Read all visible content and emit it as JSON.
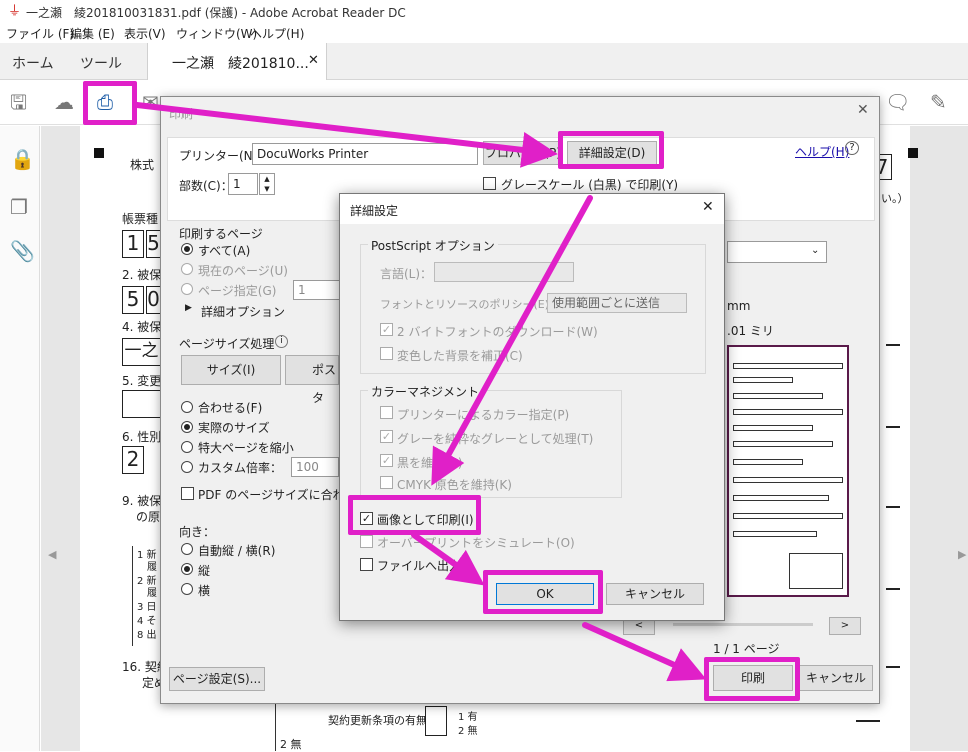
{
  "window": {
    "title": "一之瀬　綾201810031831.pdf (保護) - Adobe Acrobat Reader DC"
  },
  "menu": [
    "ファイル (F)",
    "編集 (E)",
    "表示(V)",
    "ウィンドウ(W)",
    "ヘルプ(H)"
  ],
  "tabs": {
    "home": "ホーム",
    "tools": "ツール",
    "document": "一之瀬　綾201810..."
  },
  "toolbar_icons": [
    "save-icon",
    "upload-icon",
    "print-icon",
    "mail-icon"
  ],
  "rail_icons": [
    "lock-icon",
    "copy-icon",
    "paperclip-icon"
  ],
  "document": {
    "items": [
      "株式",
      "帳票種",
      "2. 被保",
      "4. 被保",
      "5. 変更",
      "6. 性別",
      "9. 被保",
      "の原",
      "16. 契約",
      "定め",
      "2 無"
    ],
    "digits": [
      "1",
      "5",
      "5",
      "0",
      "一之",
      "2"
    ],
    "list_left": [
      "1 新",
      "履",
      "2 新",
      "履",
      "3 日",
      "4 そ",
      "8 出"
    ],
    "bottom_label": "契約更新条項の有無",
    "bottom_options": [
      "1 有",
      "2 無"
    ],
    "right_note": "さい。）",
    "right_marks": [
      "7"
    ]
  },
  "print_dialog": {
    "title": "印刷",
    "printer_label": "プリンター(N)：",
    "printer_value": "DocuWorks Printer",
    "properties_button": "プロパティ(P)",
    "advanced_button": "詳細設定(D)",
    "help_link": "ヘルプ(H)",
    "copies_label": "部数(C)：",
    "copies_value": "1",
    "grayscale_label": "グレースケール (白黒) で印刷(Y)",
    "pages_group": "印刷するページ",
    "pages_all": "すべて(A)",
    "pages_current": "現在のページ(U)",
    "pages_range": "ページ指定(G)",
    "pages_range_value": "1",
    "more_options": "詳細オプション",
    "sizing_group": "ページサイズ処理",
    "size_button": "サイズ(I)",
    "poster_button": "ポスタ",
    "fit": "合わせる(F)",
    "actual": "実際のサイズ",
    "shrink": "特大ページを縮小",
    "custom": "カスタム倍率：",
    "custom_value": "100",
    "choose_paper": "PDF のページサイズに合わせ",
    "orientation_label": "向き：",
    "auto": "自動縦 / 横(R)",
    "portrait": "縦",
    "landscape": "横",
    "page_setup_button": "ページ設定(S)...",
    "preview_mm": "mm",
    "preview_scale": ".01 ミリ",
    "preview_pager": "1 / 1 ページ",
    "prev_button": "<",
    "next_button": ">",
    "print_button": "印刷",
    "cancel_button": "キャンセル"
  },
  "advanced_dialog": {
    "title": "詳細設定",
    "postscript_group": "PostScript オプション",
    "language_label": "言語(L)：",
    "font_policy_label": "フォントとリソースのポリシー(E)：",
    "font_policy_value": "使用範囲ごとに送信",
    "two_byte": "2 バイトフォントのダウンロード(W)",
    "discolored_bg": "変色した背景を補正(C)",
    "color_group": "カラーマネジメント",
    "printer_color": "プリンターによるカラー指定(P)",
    "gray_as_gray": "グレーを純粋なグレーとして処理(T)",
    "black_preserve": "黒を維持(B)",
    "cmyk_preserve": "CMYK 原色を維持(K)",
    "print_as_image": "画像として印刷(I)",
    "overprint": "オーバープリントをシミュレート(O)",
    "print_to_file": "ファイルへ出力",
    "ok_button": "OK",
    "cancel_button": "キャンセル"
  },
  "colors": {
    "highlight": "#e020c8",
    "link": "#1a0dab",
    "dialog_bg": "#f0f0f0"
  }
}
